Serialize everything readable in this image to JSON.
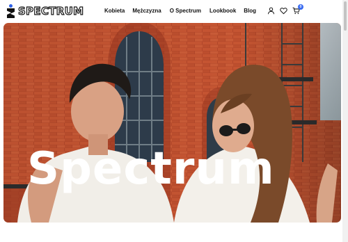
{
  "brand": {
    "name": "SPECTRUM",
    "accent": "#2f62e8"
  },
  "nav": {
    "items": [
      {
        "label": "Kobieta"
      },
      {
        "label": "Mężczyzna"
      },
      {
        "label": "O Spectrum"
      },
      {
        "label": "Lookbook"
      },
      {
        "label": "Blog"
      }
    ]
  },
  "header_icons": {
    "account": "user-icon",
    "wishlist": "heart-icon",
    "cart": "cart-icon",
    "cart_count": "0",
    "badge_color": "#3b6cf0"
  },
  "hero": {
    "title": "Spectrum",
    "image": "photo of smiling young man and woman in white t-shirts in front of red brick building"
  }
}
